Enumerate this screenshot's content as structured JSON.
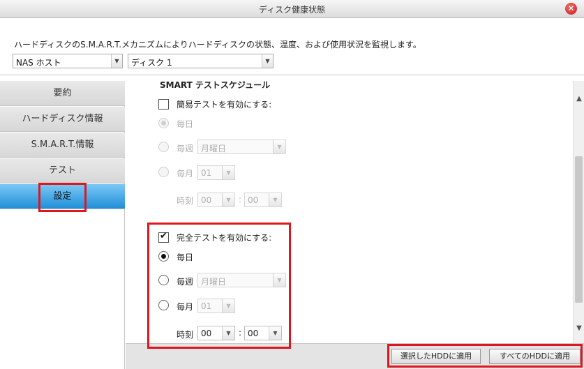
{
  "window": {
    "title": "ディスク健康状態",
    "close_symbol": "✕"
  },
  "description": "ハードディスクのS.M.A.R.T.メカニズムによりハードディスクの状態、温度、および使用状況を監視します。",
  "selectors": {
    "host": "NAS ホスト",
    "disk": "ディスク 1",
    "arrow": "▼"
  },
  "sidebar": {
    "items": [
      {
        "label": "要約"
      },
      {
        "label": "ハードディスク情報"
      },
      {
        "label": "S.M.A.R.T.情報"
      },
      {
        "label": "テスト"
      },
      {
        "label": "設定"
      }
    ]
  },
  "schedule": {
    "title": "SMART テストスケジュール",
    "quick": {
      "enable_label": "簡易テストを有効にする:",
      "daily": "毎日",
      "weekly": "毎週",
      "weekday": "月曜日",
      "monthly": "毎月",
      "day": "01",
      "time_label": "時刻",
      "hour": "00",
      "minute": "00",
      "colon": ":"
    },
    "full": {
      "enable_label": "完全テストを有効にする:",
      "daily": "毎日",
      "weekly": "毎週",
      "weekday": "月曜日",
      "monthly": "毎月",
      "day": "01",
      "time_label": "時刻",
      "hour": "00",
      "minute": "00",
      "colon": ":"
    }
  },
  "buttons": {
    "apply_selected": "選択したHDDに適用",
    "apply_all": "すべてのHDDに適用"
  },
  "scrollbar": {
    "up": "▲",
    "down": "▼"
  },
  "colors": {
    "highlight": "#e0161f",
    "active_tab": "#1f8fd8"
  }
}
